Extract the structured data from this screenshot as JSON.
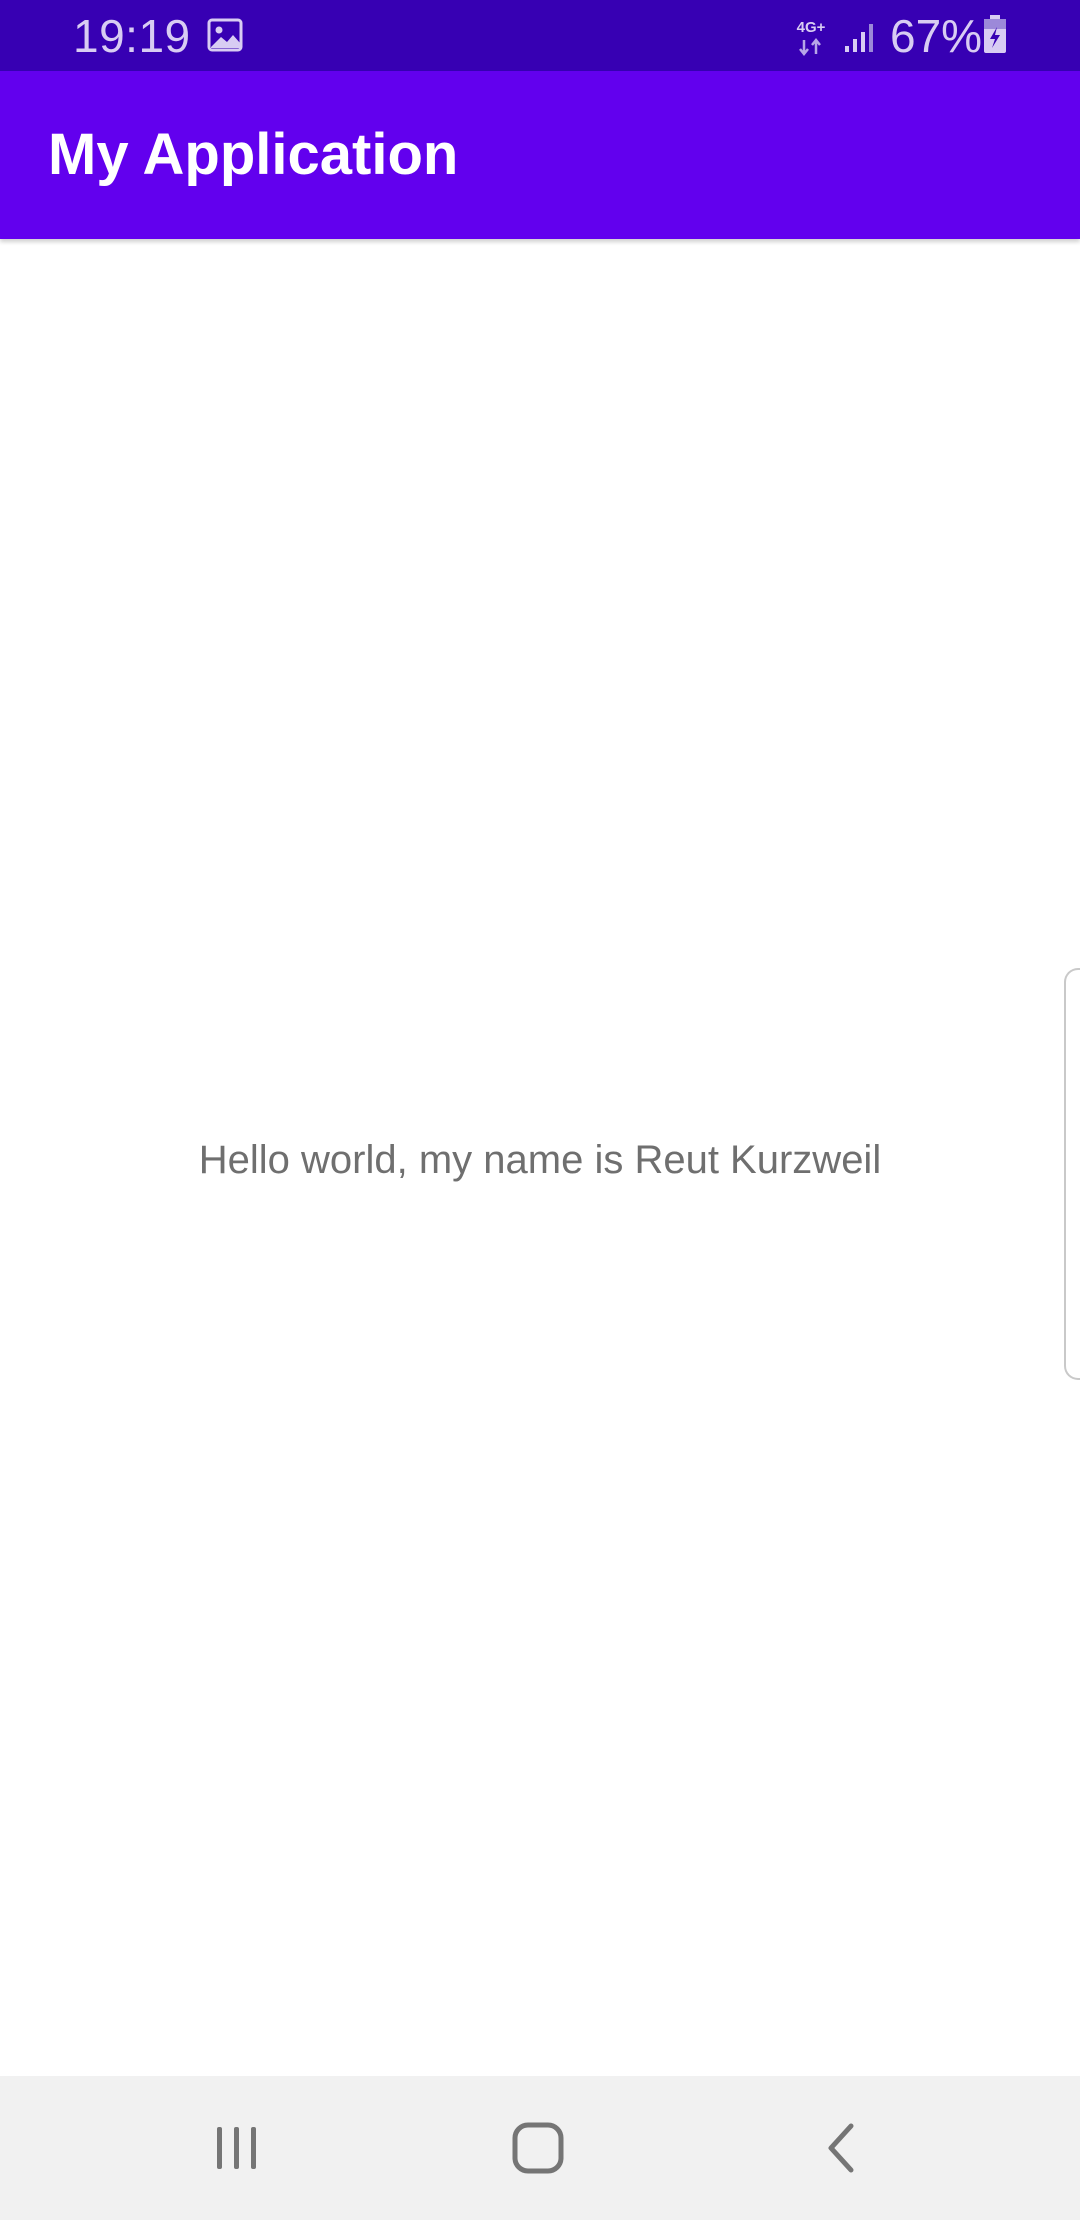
{
  "status_bar": {
    "time": "19:19",
    "network_type": "4G+",
    "battery_percent": "67%",
    "icons": [
      "gallery-icon",
      "network-4g-icon",
      "signal-icon",
      "battery-charging-icon"
    ],
    "colors": {
      "background": "#3700b3",
      "foreground": "#d8ccf3"
    }
  },
  "app_bar": {
    "title": "My Application",
    "colors": {
      "background": "#6200ee",
      "title": "#ffffff"
    }
  },
  "main": {
    "message": "Hello world, my name is Reut Kurzweil",
    "text_color": "#6f6f6f"
  },
  "nav_bar": {
    "buttons": [
      "recents-icon",
      "home-icon",
      "back-icon"
    ],
    "background": "#f1f1f1"
  }
}
